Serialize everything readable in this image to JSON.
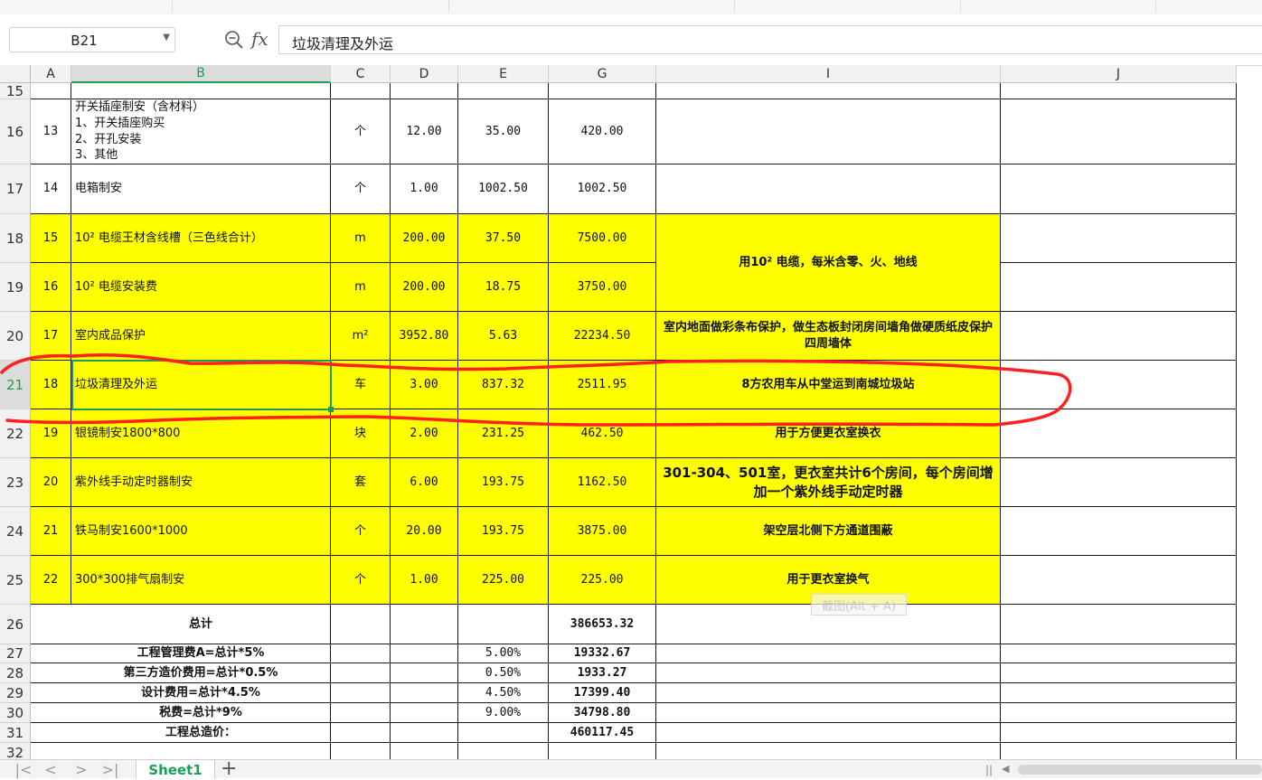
{
  "formula_bar": {
    "name_box": "B21",
    "fx_label": "fx",
    "formula": "垃圾清理及外运",
    "zoom_icon": "zoom-formula-icon"
  },
  "column_headers": [
    "A",
    "B",
    "C",
    "D",
    "E",
    "G",
    "I",
    "J"
  ],
  "rows": [
    {
      "row": "15",
      "cells": [
        "",
        "",
        "",
        "",
        "",
        "",
        "",
        ""
      ]
    },
    {
      "row": "16",
      "cells": [
        "13",
        "开关插座制安（含材料）\n1、开关插座购买\n2、开孔安装\n3、其他",
        "个",
        "12.00",
        "35.00",
        "420.00",
        "",
        ""
      ]
    },
    {
      "row": "17",
      "cells": [
        "14",
        "电箱制安",
        "个",
        "1.00",
        "1002.50",
        "1002.50",
        "",
        ""
      ]
    },
    {
      "row": "18",
      "cells": [
        "15",
        "10² 电缆王材含线槽（三色线合计）",
        "m",
        "200.00",
        "37.50",
        "7500.00",
        "",
        ""
      ]
    },
    {
      "row": "19",
      "cells": [
        "16",
        "10² 电缆安装费",
        "m",
        "200.00",
        "18.75",
        "3750.00",
        "",
        ""
      ]
    },
    {
      "row": "20",
      "cells": [
        "17",
        "室内成品保护",
        "m²",
        "3952.80",
        "5.63",
        "22234.50",
        "室内地面做彩条布保护，做生态板封闭房间墙角做硬质纸皮保护四周墙体",
        ""
      ]
    },
    {
      "row": "21",
      "cells": [
        "18",
        "垃圾清理及外运",
        "车",
        "3.00",
        "837.32",
        "2511.95",
        "8方农用车从中堂运到南城垃圾站",
        ""
      ]
    },
    {
      "row": "22",
      "cells": [
        "19",
        "银镜制安1800*800",
        "块",
        "2.00",
        "231.25",
        "462.50",
        "用于方便更衣室换衣",
        ""
      ]
    },
    {
      "row": "23",
      "cells": [
        "20",
        "紫外线手动定时器制安",
        "套",
        "6.00",
        "193.75",
        "1162.50",
        "301-304、501室，更衣室共计6个房间，每个房间增加一个紫外线手动定时器",
        ""
      ]
    },
    {
      "row": "24",
      "cells": [
        "21",
        "铁马制安1600*1000",
        "个",
        "20.00",
        "193.75",
        "3875.00",
        "架空层北侧下方通道围蔽",
        ""
      ]
    },
    {
      "row": "25",
      "cells": [
        "22",
        "300*300排气扇制安",
        "个",
        "1.00",
        "225.00",
        "225.00",
        "用于更衣室换气",
        ""
      ]
    },
    {
      "row": "26",
      "cells": [
        "",
        "总计",
        "",
        "",
        "",
        "386653.32",
        "",
        ""
      ]
    },
    {
      "row": "27",
      "cells": [
        "",
        "工程管理费A=总计*5%",
        "",
        "",
        "5.00%",
        "19332.67",
        "",
        ""
      ]
    },
    {
      "row": "28",
      "cells": [
        "",
        "第三方造价费用=总计*0.5%",
        "",
        "",
        "0.50%",
        "1933.27",
        "",
        ""
      ]
    },
    {
      "row": "29",
      "cells": [
        "",
        "设计费用=总计*4.5%",
        "",
        "",
        "4.50%",
        "17399.40",
        "",
        ""
      ]
    },
    {
      "row": "30",
      "cells": [
        "",
        "税费=总计*9%",
        "",
        "",
        "9.00%",
        "34798.80",
        "",
        ""
      ]
    },
    {
      "row": "31",
      "cells": [
        "",
        "工程总造价：",
        "",
        "",
        "",
        "460117.45",
        "",
        ""
      ]
    },
    {
      "row": "32",
      "cells": [
        "",
        "",
        "",
        "",
        "",
        "",
        "",
        ""
      ]
    }
  ],
  "merged_note_18_19": "用10² 电缆，每米含零、火、地线",
  "active_cell": "B21",
  "overlay": {
    "screenshot_tooltip": "截图(Alt + A)",
    "annotation_color": "#ff2020"
  },
  "sheet_tabs": {
    "active": "Sheet1",
    "add_label": "+",
    "nav": [
      "|<",
      "<",
      ">",
      ">|"
    ],
    "scroll_sep": "||",
    "scroll_left": "◀"
  },
  "colors": {
    "highlight": "#ffff00",
    "accent": "#1e9d57"
  }
}
